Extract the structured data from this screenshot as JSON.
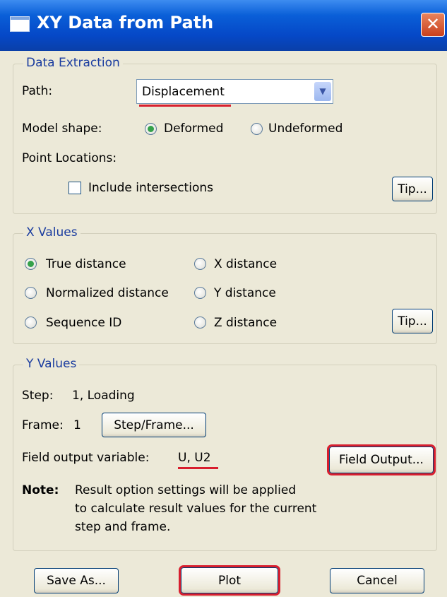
{
  "window": {
    "title": "XY Data from Path",
    "close_glyph": "✕"
  },
  "data_extraction": {
    "legend": "Data Extraction",
    "path_label": "Path:",
    "path_value": "Displacement",
    "model_shape_label": "Model shape:",
    "model_shape_options": [
      "Deformed",
      "Undeformed"
    ],
    "model_shape_selected": "Deformed",
    "point_locations_label": "Point Locations:",
    "include_intersections_label": "Include intersections",
    "include_intersections_checked": false,
    "tip_label": "Tip..."
  },
  "x_values": {
    "legend": "X Values",
    "options": [
      "True distance",
      "Normalized distance",
      "Sequence ID",
      "X distance",
      "Y distance",
      "Z distance"
    ],
    "selected": "True distance",
    "tip_label": "Tip..."
  },
  "y_values": {
    "legend": "Y Values",
    "step_label": "Step:",
    "step_value": "1, Loading",
    "frame_label": "Frame:",
    "frame_value": "1",
    "step_frame_button": "Step/Frame...",
    "field_output_variable_label": "Field output variable:",
    "field_output_variable_value": "U, U2",
    "field_output_button": "Field Output...",
    "note_label": "Note:",
    "note_lines": [
      "Result option settings will be applied",
      "to calculate result values for the current",
      "step and frame."
    ]
  },
  "footer": {
    "save_as": "Save As...",
    "plot": "Plot",
    "cancel": "Cancel"
  },
  "colors": {
    "title_bar": "#0a5fd8",
    "group_legend": "#1a3c9f",
    "highlight": "#d81e2e",
    "dialog_bg": "#ece9d8",
    "radio_selected": "#35a14b"
  },
  "icons": {
    "window_icon": "window-icon",
    "close_icon": "close-icon",
    "dropdown_icon": "chevron-down-icon"
  }
}
